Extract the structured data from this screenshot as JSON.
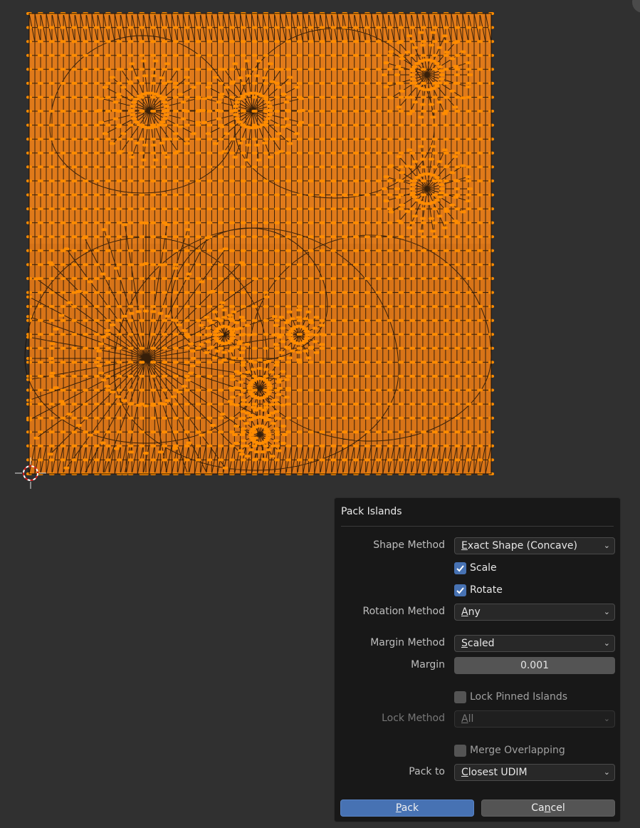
{
  "colors": {
    "background": "#303030",
    "uv_fill": "#e07a1a",
    "uv_vertex": "#ff8c00",
    "uv_edge": "#1a1008",
    "dialog_bg": "#181818",
    "accent": "#4772b3"
  },
  "dialog": {
    "title": "Pack Islands",
    "shape_method": {
      "label": "Shape Method",
      "value": "Exact Shape (Concave)",
      "mnemonic": "E",
      "rest": "xact Shape (Concave)"
    },
    "scale": {
      "label": "Scale",
      "checked": true
    },
    "rotate": {
      "label": "Rotate",
      "checked": true
    },
    "rotation_method": {
      "label": "Rotation Method",
      "value": "Any",
      "mnemonic": "A",
      "rest": "ny"
    },
    "margin_method": {
      "label": "Margin Method",
      "value": "Scaled",
      "mnemonic": "S",
      "rest": "caled"
    },
    "margin": {
      "label": "Margin",
      "value": "0.001"
    },
    "lock_pinned": {
      "label": "Lock Pinned Islands",
      "checked": false
    },
    "lock_method": {
      "label": "Lock Method",
      "value": "All",
      "mnemonic": "A",
      "rest": "ll",
      "disabled": true
    },
    "merge_overlapping": {
      "label": "Merge Overlapping",
      "checked": false
    },
    "pack_to": {
      "label": "Pack to",
      "value": "Closest UDIM",
      "mnemonic": "C",
      "rest": "losest UDIM"
    },
    "pack_button": {
      "mnemonic": "P",
      "rest": "ack",
      "label": "Pack"
    },
    "cancel_button": {
      "pre": "Ca",
      "mnemonic": "n",
      "rest": "cel",
      "label": "Cancel"
    }
  },
  "icons": {
    "cursor": "2d-cursor-icon",
    "chevron": "chevron-down-icon",
    "check": "checkmark-icon"
  }
}
